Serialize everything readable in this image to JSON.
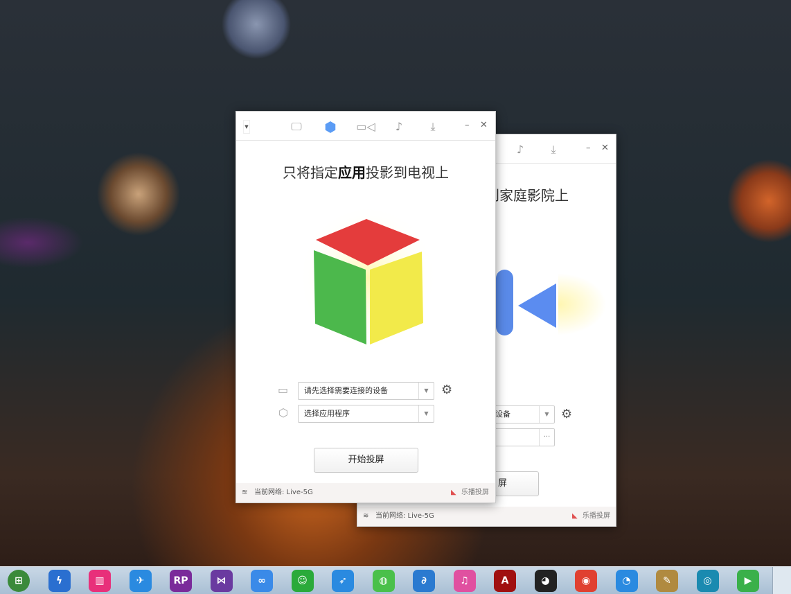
{
  "back_window": {
    "heading": "到家庭影院上",
    "device_select": "设备",
    "more_label": "···",
    "start_button": "屏",
    "network": "当前网络: Live-5G",
    "brand": "乐播投屏"
  },
  "front_window": {
    "tabs": [
      {
        "icon": "monitor-icon"
      },
      {
        "icon": "hexagon-app-icon",
        "active": true
      },
      {
        "icon": "video-camera-icon"
      },
      {
        "icon": "music-note-icon"
      },
      {
        "icon": "download-icon"
      }
    ],
    "heading_pre": "只将指定",
    "heading_bold": "应用",
    "heading_post": "投影到电视上",
    "device_placeholder": "请先选择需要连接的设备",
    "app_placeholder": "选择应用程序",
    "start_button": "开始投屏",
    "network": "当前网络: Live-5G",
    "brand": "乐播投屏",
    "accent": "#5b9cf5"
  },
  "taskbar": {
    "items": [
      {
        "name": "start-orb",
        "color": "#3a8a3a",
        "glyph": "⊞"
      },
      {
        "name": "thunder",
        "color": "#2a6fd0",
        "glyph": "ϟ"
      },
      {
        "name": "app-pink",
        "color": "#e8307a",
        "glyph": "▥"
      },
      {
        "name": "feishu",
        "color": "#2a8ae0",
        "glyph": "✈"
      },
      {
        "name": "axure-rp",
        "color": "#7a2a9a",
        "glyph": "RP"
      },
      {
        "name": "visual-studio",
        "color": "#6a3aa0",
        "glyph": "⋈"
      },
      {
        "name": "baidu-cloud",
        "color": "#3a8ae8",
        "glyph": "∞"
      },
      {
        "name": "chat-green",
        "color": "#2aaa3a",
        "glyph": "☺"
      },
      {
        "name": "dingtalk",
        "color": "#2a8ae0",
        "glyph": "➶"
      },
      {
        "name": "wechat",
        "color": "#4ac04a",
        "glyph": "◍"
      },
      {
        "name": "app-blue",
        "color": "#2a7ad0",
        "glyph": "∂"
      },
      {
        "name": "itunes",
        "color": "#e050a0",
        "glyph": "♫"
      },
      {
        "name": "acrobat",
        "color": "#a01010",
        "glyph": "A"
      },
      {
        "name": "qq",
        "color": "#222222",
        "glyph": "◕"
      },
      {
        "name": "chrome",
        "color": "#e04030",
        "glyph": "◉"
      },
      {
        "name": "qq-browser",
        "color": "#2a8ae0",
        "glyph": "◔"
      },
      {
        "name": "paint",
        "color": "#b08a40",
        "glyph": "✎"
      },
      {
        "name": "video-player",
        "color": "#1a8ab0",
        "glyph": "◎"
      },
      {
        "name": "media-play",
        "color": "#3ab04a",
        "glyph": "▶"
      }
    ]
  }
}
